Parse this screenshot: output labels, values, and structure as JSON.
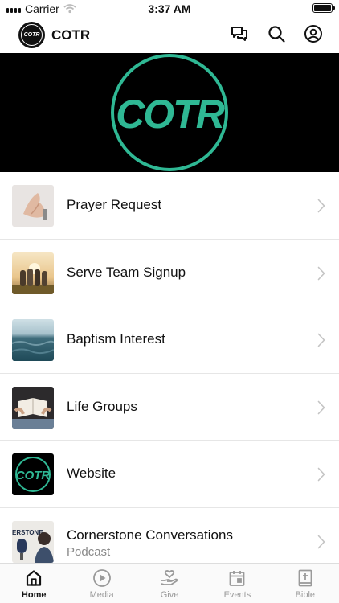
{
  "status_bar": {
    "carrier": "Carrier",
    "time": "3:37 AM"
  },
  "nav": {
    "title": "COTR",
    "logo_text": "COTR"
  },
  "hero": {
    "logo_text": "COTR",
    "accent_color": "#2fb894"
  },
  "items": [
    {
      "label": "Prayer Request",
      "subtitle": ""
    },
    {
      "label": "Serve Team Signup",
      "subtitle": ""
    },
    {
      "label": "Baptism Interest",
      "subtitle": ""
    },
    {
      "label": "Life Groups",
      "subtitle": ""
    },
    {
      "label": "Website",
      "subtitle": ""
    },
    {
      "label": "Cornerstone Conversations",
      "subtitle": "Podcast"
    }
  ],
  "thumb_texts": {
    "website": "COTR",
    "podcast": "ERSTONE"
  },
  "tabs": [
    {
      "label": "Home",
      "icon": "home-icon",
      "active": true
    },
    {
      "label": "Media",
      "icon": "play-icon",
      "active": false
    },
    {
      "label": "Give",
      "icon": "give-icon",
      "active": false
    },
    {
      "label": "Events",
      "icon": "calendar-icon",
      "active": false
    },
    {
      "label": "Bible",
      "icon": "bible-icon",
      "active": false
    }
  ]
}
